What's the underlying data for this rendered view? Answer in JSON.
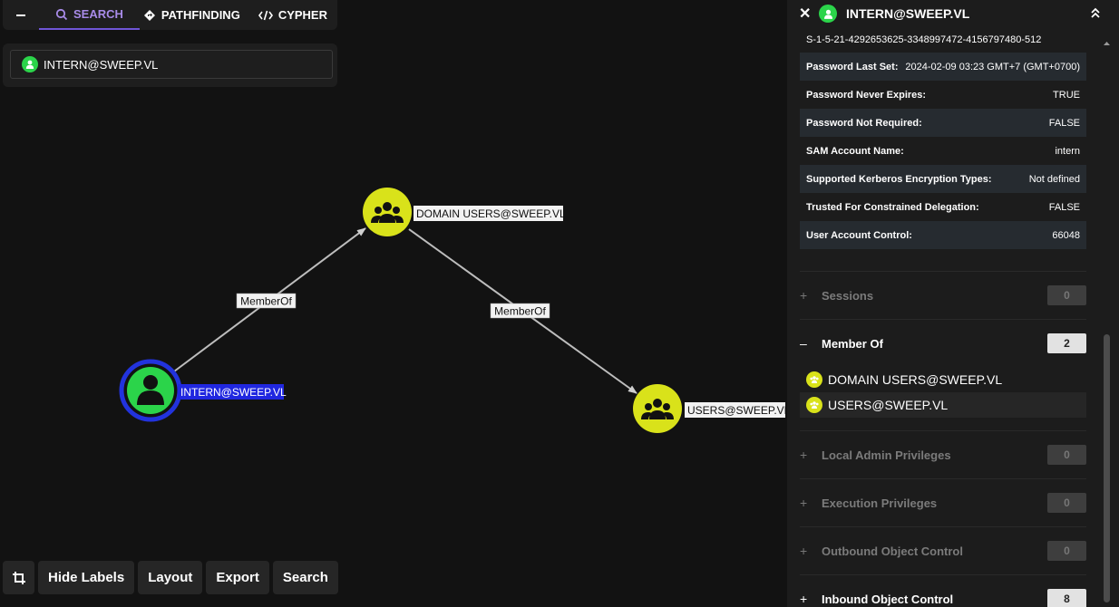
{
  "nav": {
    "tabs": [
      {
        "label": "SEARCH",
        "icon": "magnifier-icon",
        "active": true
      },
      {
        "label": "PATHFINDING",
        "icon": "diamond-route-icon",
        "active": false
      },
      {
        "label": "CYPHER",
        "icon": "code-brackets-icon",
        "active": false
      }
    ]
  },
  "search": {
    "value": "INTERN@SWEEP.VL"
  },
  "graph": {
    "nodes": [
      {
        "id": "intern",
        "label": "INTERN@SWEEP.VL",
        "type": "user",
        "selected": true
      },
      {
        "id": "domainusers",
        "label": "DOMAIN USERS@SWEEP.VL",
        "type": "group",
        "selected": false
      },
      {
        "id": "users",
        "label": "USERS@SWEEP.VL",
        "type": "group",
        "selected": false
      }
    ],
    "edges": [
      {
        "from": "intern",
        "to": "domainusers",
        "label": "MemberOf"
      },
      {
        "from": "domainusers",
        "to": "users",
        "label": "MemberOf"
      }
    ]
  },
  "toolbar": {
    "crop_icon": "crop-icon",
    "hide_labels": "Hide Labels",
    "layout": "Layout",
    "export": "Export",
    "search": "Search"
  },
  "panel": {
    "title": "INTERN@SWEEP.VL",
    "sid": "S-1-5-21-4292653625-3348997472-4156797480-512",
    "properties": [
      {
        "key": "Password Last Set:",
        "value": "2024-02-09 03:23 GMT+7 (GMT+0700)"
      },
      {
        "key": "Password Never Expires:",
        "value": "TRUE"
      },
      {
        "key": "Password Not Required:",
        "value": "FALSE"
      },
      {
        "key": "SAM Account Name:",
        "value": "intern"
      },
      {
        "key": "Supported Kerberos Encryption Types:",
        "value": "Not defined"
      },
      {
        "key": "Trusted For Constrained Delegation:",
        "value": "FALSE"
      },
      {
        "key": "User Account Control:",
        "value": "66048"
      }
    ],
    "sections": [
      {
        "title": "Sessions",
        "count": "0",
        "sign": "+",
        "active": false
      },
      {
        "title": "Member Of",
        "count": "2",
        "sign": "–",
        "active": true
      },
      {
        "title": "Local Admin Privileges",
        "count": "0",
        "sign": "+",
        "active": false
      },
      {
        "title": "Execution Privileges",
        "count": "0",
        "sign": "+",
        "active": false
      },
      {
        "title": "Outbound Object Control",
        "count": "0",
        "sign": "+",
        "active": false
      },
      {
        "title": "Inbound Object Control",
        "count": "8",
        "sign": "+",
        "active": true
      }
    ],
    "member_of": [
      "DOMAIN USERS@SWEEP.VL",
      "USERS@SWEEP.VL"
    ]
  },
  "colors": {
    "user_node": "#2bd44a",
    "group_node": "#d9e21a",
    "selected_ring": "#2233dd",
    "accent": "#a88be8"
  }
}
